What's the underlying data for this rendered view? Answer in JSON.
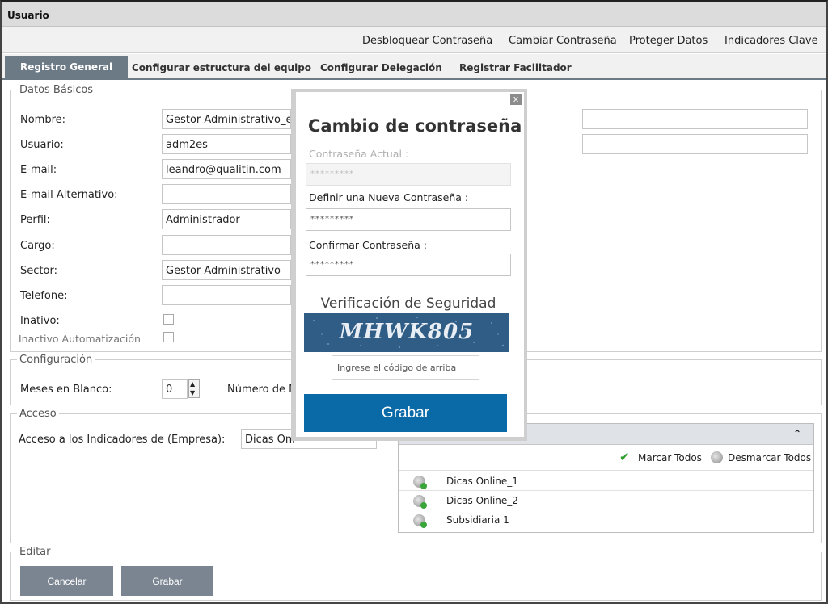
{
  "window": {
    "title": "Usuario"
  },
  "top_menu": [
    "Desbloquear Contraseña",
    "Cambiar Contraseña",
    "Proteger Datos",
    "Indicadores Clave"
  ],
  "tabs": [
    "Registro General",
    "Configurar estructura del equipo",
    "Configurar Delegación",
    "Registrar Facilitador"
  ],
  "datos_basicos": {
    "legend": "Datos Básicos",
    "nombre_label": "Nombre:",
    "nombre_value": "Gestor Administrativo_es",
    "usuario_label": "Usuario:",
    "usuario_value": "adm2es",
    "email_label": "E-mail:",
    "email_value": "leandro@qualitin.com",
    "email_alt_label": "E-mail Alternativo:",
    "email_alt_value": "",
    "perfil_label": "Perfil:",
    "perfil_value": "Administrador",
    "cargo_label": "Cargo:",
    "cargo_value": "",
    "sector_label": "Sector:",
    "sector_value": "Gestor Administrativo",
    "telefone_label": "Telefone:",
    "telefone_value": "",
    "inativo_label": "Inativo:",
    "inactivo_auto_label": "Inactivo Automatización"
  },
  "configuracion": {
    "legend": "Configuración",
    "meses_label": "Meses en Blanco:",
    "meses_value": "0",
    "numero_label": "Número de M"
  },
  "acceso": {
    "legend": "Acceso",
    "indicadores_label": "Acceso a los Indicadores de (Empresa):",
    "empresa_value": "Dicas Onl",
    "marcar_label": "Marcar Todos",
    "desmarcar_label": "Desmarcar Todos",
    "items": [
      "Dicas Online_1",
      "Dicas Online_2",
      "Subsidiaria 1"
    ]
  },
  "editar": {
    "legend": "Editar",
    "cancel_label": "Cancelar",
    "save_label": "Grabar"
  },
  "modal": {
    "close": "x",
    "title": "Cambio de contraseña",
    "current_label": "Contraseña Actual :",
    "current_value": "*********",
    "new_label": "Definir una Nueva Contraseña :",
    "new_value": "*********",
    "confirm_label": "Confirmar Contraseña :",
    "confirm_value": "*********",
    "captcha_title": "Verificación de Seguridad",
    "captcha_text": "MHWK805",
    "captcha_placeholder": "Ingrese el código de arriba",
    "save_label": "Grabar"
  },
  "colors": {
    "tab_active": "#6c7a86",
    "modal_button": "#0a6aa8",
    "button_gray": "#7a8591"
  }
}
